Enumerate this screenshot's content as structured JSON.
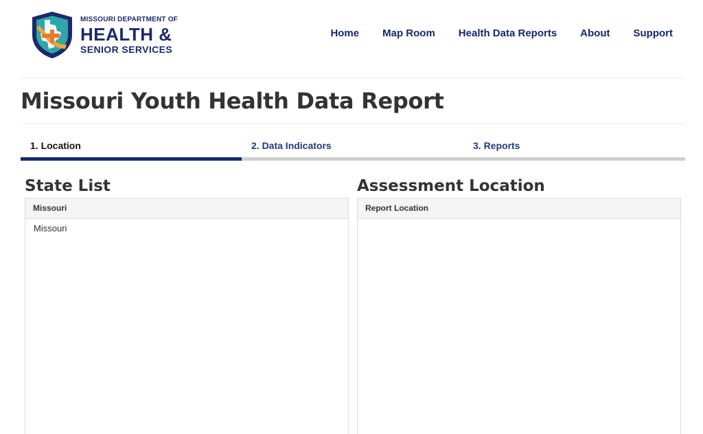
{
  "logo": {
    "line1": "MISSOURI DEPARTMENT OF",
    "line2": "HEALTH &",
    "line3": "SENIOR SERVICES",
    "icon": "shield-logo-icon",
    "colors": {
      "navy": "#1b2a6b",
      "teal": "#2fa6a8",
      "orange": "#f2a33a"
    }
  },
  "nav": {
    "items": [
      {
        "label": "Home"
      },
      {
        "label": "Map Room"
      },
      {
        "label": "Health Data Reports"
      },
      {
        "label": "About"
      },
      {
        "label": "Support"
      }
    ]
  },
  "page": {
    "title": "Missouri Youth Health Data Report"
  },
  "tabs": [
    {
      "label": "1. Location",
      "active": true
    },
    {
      "label": "2. Data Indicators",
      "active": false
    },
    {
      "label": "3. Reports",
      "active": false
    }
  ],
  "state_list": {
    "heading": "State List",
    "column_header": "Missouri",
    "items": [
      {
        "label": "Missouri"
      }
    ]
  },
  "assessment": {
    "heading": "Assessment Location",
    "column_header": "Report Location",
    "items": []
  },
  "colors": {
    "tab_active": "#122a6e",
    "tab_inactive": "#cfcfcf",
    "nav_text": "#14286a"
  }
}
